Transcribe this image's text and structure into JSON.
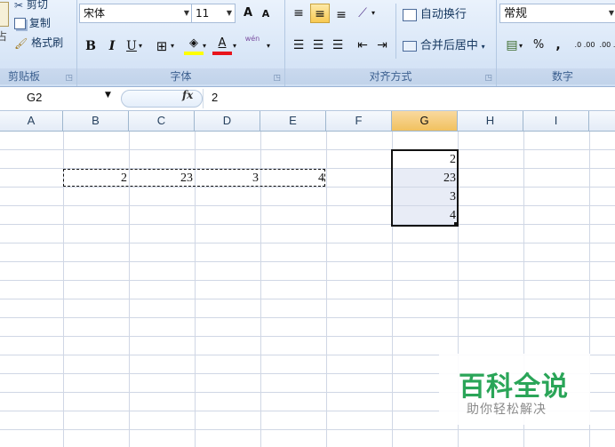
{
  "ribbon": {
    "clipboard": {
      "cut_label": "剪切",
      "copy_label": "复制",
      "format_painter_label": "格式刷",
      "paste_fragment": "占",
      "group_label": "剪贴板"
    },
    "font": {
      "font_name": "宋体",
      "font_size": "11",
      "grow_label": "A",
      "shrink_label": "A",
      "bold": "B",
      "italic": "I",
      "underline": "U",
      "font_color_label": "A",
      "phonetic_label": "wén",
      "group_label": "字体"
    },
    "alignment": {
      "wrap_text_label": "自动换行",
      "merge_center_label": "合并后居中",
      "group_label": "对齐方式"
    },
    "number": {
      "format_value": "常规",
      "percent": "%",
      "comma": ",",
      "inc_decimal": ".0 .00",
      "dec_decimal": ".00 .0",
      "group_label": "数字"
    }
  },
  "formula_bar": {
    "name_box": "G2",
    "fx_label": "fx",
    "value": "2"
  },
  "columns": [
    "A",
    "B",
    "C",
    "D",
    "E",
    "F",
    "G",
    "H",
    "I"
  ],
  "selected_column": "G",
  "row1": {
    "B": "2",
    "C": "23",
    "D": "3",
    "E": "4"
  },
  "col_g": [
    "2",
    "23",
    "3",
    "4"
  ],
  "watermark": {
    "title": "百科全说",
    "subtitle": "助你轻松解决"
  },
  "colors": {
    "ribbon_bg": "#dbe8f8",
    "selected_header": "#f1c15f",
    "selection_fill": "#e8ecf6",
    "watermark_green": "#2aa558"
  }
}
